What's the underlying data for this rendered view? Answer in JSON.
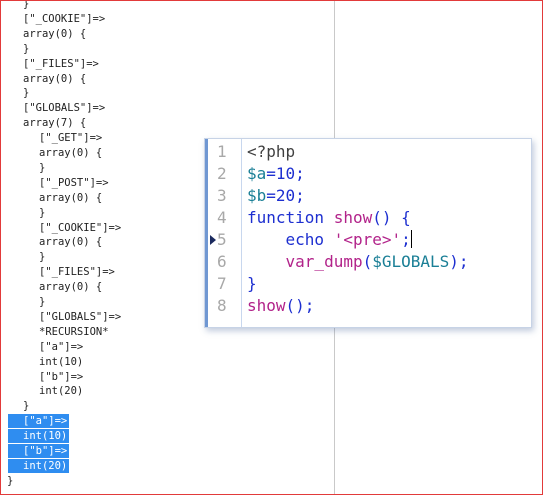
{
  "dump_lines": [
    {
      "text": "}",
      "indent": 1,
      "selected": false
    },
    {
      "text": "[\"_COOKIE\"]=>",
      "indent": 1,
      "selected": false
    },
    {
      "text": "array(0) {",
      "indent": 1,
      "selected": false
    },
    {
      "text": "}",
      "indent": 1,
      "selected": false
    },
    {
      "text": "[\"_FILES\"]=>",
      "indent": 1,
      "selected": false
    },
    {
      "text": "array(0) {",
      "indent": 1,
      "selected": false
    },
    {
      "text": "}",
      "indent": 1,
      "selected": false
    },
    {
      "text": "[\"GLOBALS\"]=>",
      "indent": 1,
      "selected": false
    },
    {
      "text": "array(7) {",
      "indent": 1,
      "selected": false
    },
    {
      "text": "[\"_GET\"]=>",
      "indent": 2,
      "selected": false
    },
    {
      "text": "array(0) {",
      "indent": 2,
      "selected": false
    },
    {
      "text": "}",
      "indent": 2,
      "selected": false
    },
    {
      "text": "[\"_POST\"]=>",
      "indent": 2,
      "selected": false
    },
    {
      "text": "array(0) {",
      "indent": 2,
      "selected": false
    },
    {
      "text": "}",
      "indent": 2,
      "selected": false
    },
    {
      "text": "[\"_COOKIE\"]=>",
      "indent": 2,
      "selected": false
    },
    {
      "text": "array(0) {",
      "indent": 2,
      "selected": false
    },
    {
      "text": "}",
      "indent": 2,
      "selected": false
    },
    {
      "text": "[\"_FILES\"]=>",
      "indent": 2,
      "selected": false
    },
    {
      "text": "array(0) {",
      "indent": 2,
      "selected": false
    },
    {
      "text": "}",
      "indent": 2,
      "selected": false
    },
    {
      "text": "[\"GLOBALS\"]=>",
      "indent": 2,
      "selected": false
    },
    {
      "text": "*RECURSION*",
      "indent": 2,
      "selected": false
    },
    {
      "text": "[\"a\"]=>",
      "indent": 2,
      "selected": false
    },
    {
      "text": "int(10)",
      "indent": 2,
      "selected": false
    },
    {
      "text": "[\"b\"]=>",
      "indent": 2,
      "selected": false
    },
    {
      "text": "int(20)",
      "indent": 2,
      "selected": false
    },
    {
      "text": "}",
      "indent": 1,
      "selected": false
    },
    {
      "text": "[\"a\"]=>",
      "indent": 1,
      "selected": true
    },
    {
      "text": "int(10)",
      "indent": 1,
      "selected": true
    },
    {
      "text": "[\"b\"]=>",
      "indent": 1,
      "selected": true
    },
    {
      "text": "int(20)",
      "indent": 1,
      "selected": true
    },
    {
      "text": "}",
      "indent": 0,
      "selected": false
    }
  ],
  "editor": {
    "current_line": 5,
    "lines": [
      {
        "num": "1",
        "tokens": [
          {
            "t": "<?php",
            "c": "p"
          }
        ]
      },
      {
        "num": "2",
        "tokens": [
          {
            "t": "$a",
            "c": "var"
          },
          {
            "t": "=10;",
            "c": "kw"
          }
        ]
      },
      {
        "num": "3",
        "tokens": [
          {
            "t": "$b",
            "c": "var"
          },
          {
            "t": "=20;",
            "c": "kw"
          }
        ]
      },
      {
        "num": "4",
        "tokens": [
          {
            "t": "function",
            "c": "kw"
          },
          {
            "t": " ",
            "c": "p"
          },
          {
            "t": "show",
            "c": "fn"
          },
          {
            "t": "() {",
            "c": "kw"
          }
        ]
      },
      {
        "num": "5",
        "tokens": [
          {
            "t": "    ",
            "c": "p"
          },
          {
            "t": "echo",
            "c": "kw"
          },
          {
            "t": " ",
            "c": "p"
          },
          {
            "t": "'<pre>'",
            "c": "str"
          },
          {
            "t": ";",
            "c": "kw"
          }
        ]
      },
      {
        "num": "6",
        "tokens": [
          {
            "t": "    ",
            "c": "p"
          },
          {
            "t": "var_dump",
            "c": "fn"
          },
          {
            "t": "(",
            "c": "kw"
          },
          {
            "t": "$GLOBALS",
            "c": "var"
          },
          {
            "t": ");",
            "c": "kw"
          }
        ]
      },
      {
        "num": "7",
        "tokens": [
          {
            "t": "}",
            "c": "kw"
          }
        ]
      },
      {
        "num": "8",
        "tokens": [
          {
            "t": "show",
            "c": "fn"
          },
          {
            "t": "();",
            "c": "kw"
          }
        ]
      }
    ]
  }
}
